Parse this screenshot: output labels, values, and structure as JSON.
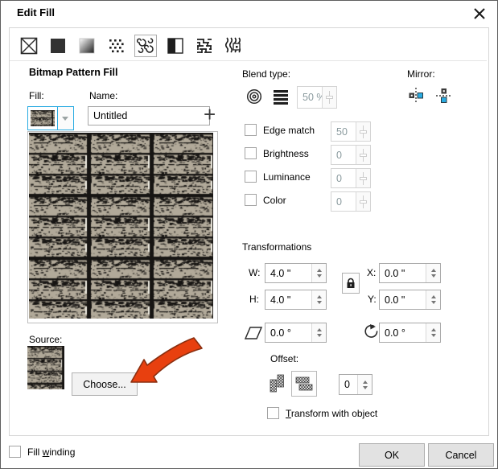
{
  "window": {
    "title": "Edit Fill"
  },
  "toolbar": {
    "selected_index": 4,
    "tools": [
      {
        "name": "no-fill"
      },
      {
        "name": "uniform-fill"
      },
      {
        "name": "fountain-fill"
      },
      {
        "name": "vector-pattern-fill"
      },
      {
        "name": "bitmap-pattern-fill"
      },
      {
        "name": "two-color-pattern-fill"
      },
      {
        "name": "texture-fill"
      },
      {
        "name": "postscript-fill"
      }
    ]
  },
  "panel": {
    "heading": "Bitmap Pattern Fill",
    "fill_label": "Fill:",
    "name_label": "Name:",
    "name_value": "Untitled",
    "add_label": "+",
    "source_label": "Source:",
    "choose_label": "Choose..."
  },
  "blend": {
    "label": "Blend type:",
    "value": "50 %"
  },
  "mirror": {
    "label": "Mirror:"
  },
  "adjustments": [
    {
      "label": "Edge match",
      "value": "50",
      "checked": false
    },
    {
      "label": "Brightness",
      "value": "0",
      "checked": false
    },
    {
      "label": "Luminance",
      "value": "0",
      "checked": false
    },
    {
      "label": "Color",
      "value": "0",
      "checked": false
    }
  ],
  "transformations": {
    "label": "Transformations",
    "w_label": "W:",
    "w_value": "4.0 \"",
    "h_label": "H:",
    "h_value": "4.0 \"",
    "x_label": "X:",
    "x_value": "0.0 \"",
    "y_label": "Y:",
    "y_value": "0.0 \"",
    "skew_value": "0.0 °",
    "rotate_value": "0.0 °"
  },
  "offset": {
    "label": "Offset:",
    "value": "0"
  },
  "transform_checkbox": {
    "pre": "",
    "accel": "T",
    "post": "ransform with object",
    "checked": false
  },
  "footer": {
    "fill_winding": {
      "pre": "Fill ",
      "accel": "w",
      "post": "inding",
      "checked": false
    },
    "ok_label": "OK",
    "cancel_label": "Cancel"
  },
  "colors": {
    "accent_cyan": "#29ABE2",
    "pattern_bg": "#b1a999",
    "pattern_ink": "#171513",
    "arrow_red": "#e8400f",
    "arrow_outline": "#8a2f10"
  }
}
